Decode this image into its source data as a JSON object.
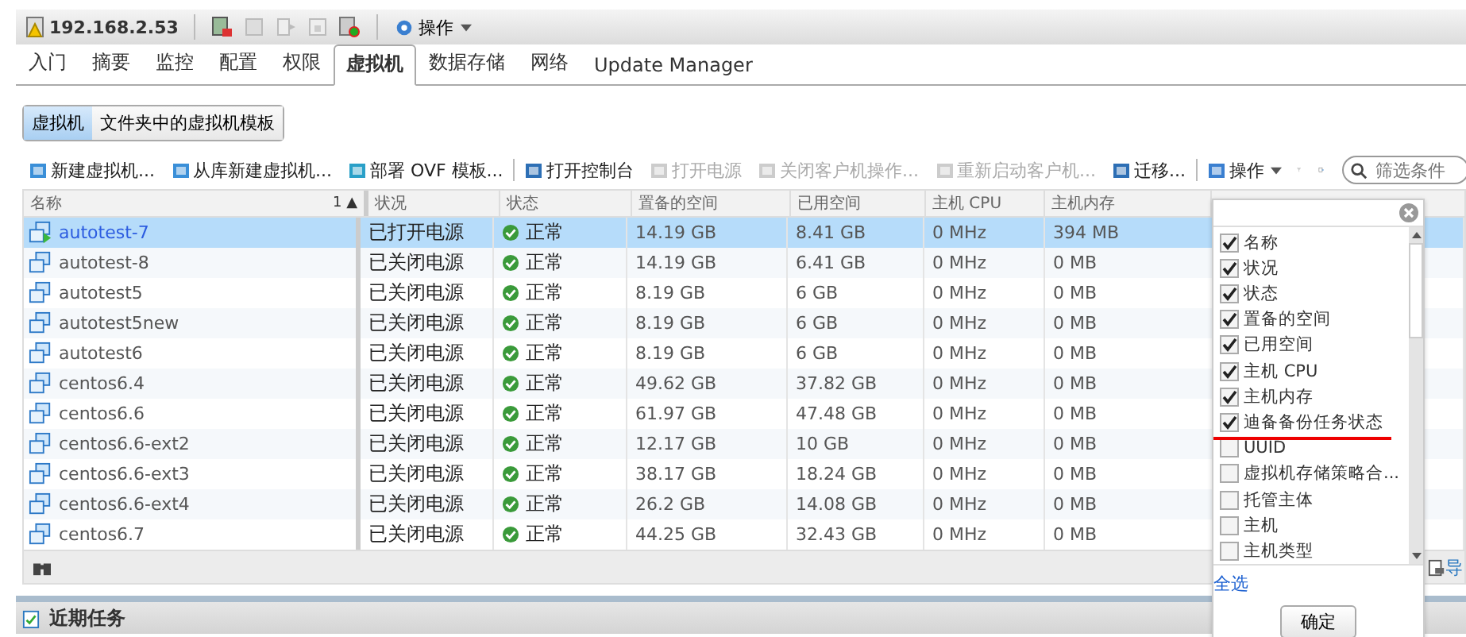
{
  "host": {
    "title": "192.168.2.53",
    "actions": "操作"
  },
  "tabs": [
    {
      "label": "入门",
      "selected": false
    },
    {
      "label": "摘要",
      "selected": false
    },
    {
      "label": "监控",
      "selected": false
    },
    {
      "label": "配置",
      "selected": false
    },
    {
      "label": "权限",
      "selected": false
    },
    {
      "label": "虚拟机",
      "selected": true
    },
    {
      "label": "数据存储",
      "selected": false
    },
    {
      "label": "网络",
      "selected": false
    },
    {
      "label": "Update Manager",
      "selected": false
    }
  ],
  "subtabs": [
    {
      "label": "虚拟机",
      "selected": true
    },
    {
      "label": "文件夹中的虚拟机模板",
      "selected": false
    }
  ],
  "toolbar": [
    {
      "label": "新建虚拟机...",
      "disabled": false
    },
    {
      "label": "从库新建虚拟机...",
      "disabled": false
    },
    {
      "label": "部署 OVF 模板...",
      "disabled": false
    },
    {
      "label": "打开控制台",
      "disabled": false
    },
    {
      "label": "打开电源",
      "disabled": true
    },
    {
      "label": "关闭客户机操作...",
      "disabled": true
    },
    {
      "label": "重新启动客户机...",
      "disabled": true
    },
    {
      "label": "迁移...",
      "disabled": false
    },
    {
      "label": "操作",
      "disabled": false
    }
  ],
  "filter": {
    "placeholder": "筛选条件"
  },
  "table": {
    "columns": [
      {
        "label": "名称",
        "sort": "1 ▲"
      },
      {
        "label": "状况"
      },
      {
        "label": "状态"
      },
      {
        "label": "置备的空间"
      },
      {
        "label": "已用空间"
      },
      {
        "label": "主机 CPU"
      },
      {
        "label": "主机内存"
      }
    ],
    "rows": [
      {
        "name": "autotest-7",
        "running": true,
        "selected": true,
        "power": "已打开电源",
        "status": "正常",
        "provisioned": "14.19  GB",
        "used": "8.41  GB",
        "cpu": "0 MHz",
        "memory": "394 MB"
      },
      {
        "name": "autotest-8",
        "running": false,
        "selected": false,
        "power": "已关闭电源",
        "status": "正常",
        "provisioned": "14.19  GB",
        "used": "6.41  GB",
        "cpu": "0 MHz",
        "memory": "0 MB"
      },
      {
        "name": "autotest5",
        "running": false,
        "selected": false,
        "power": "已关闭电源",
        "status": "正常",
        "provisioned": "8.19  GB",
        "used": "6  GB",
        "cpu": "0 MHz",
        "memory": "0 MB"
      },
      {
        "name": "autotest5new",
        "running": false,
        "selected": false,
        "power": "已关闭电源",
        "status": "正常",
        "provisioned": "8.19  GB",
        "used": "6  GB",
        "cpu": "0 MHz",
        "memory": "0 MB"
      },
      {
        "name": "autotest6",
        "running": false,
        "selected": false,
        "power": "已关闭电源",
        "status": "正常",
        "provisioned": "8.19  GB",
        "used": "6  GB",
        "cpu": "0 MHz",
        "memory": "0 MB"
      },
      {
        "name": "centos6.4",
        "running": false,
        "selected": false,
        "power": "已关闭电源",
        "status": "正常",
        "provisioned": "49.62  GB",
        "used": "37.82  GB",
        "cpu": "0 MHz",
        "memory": "0 MB"
      },
      {
        "name": "centos6.6",
        "running": false,
        "selected": false,
        "power": "已关闭电源",
        "status": "正常",
        "provisioned": "61.97  GB",
        "used": "47.48  GB",
        "cpu": "0 MHz",
        "memory": "0 MB"
      },
      {
        "name": "centos6.6-ext2",
        "running": false,
        "selected": false,
        "power": "已关闭电源",
        "status": "正常",
        "provisioned": "12.17  GB",
        "used": "10  GB",
        "cpu": "0 MHz",
        "memory": "0 MB"
      },
      {
        "name": "centos6.6-ext3",
        "running": false,
        "selected": false,
        "power": "已关闭电源",
        "status": "正常",
        "provisioned": "38.17  GB",
        "used": "18.24  GB",
        "cpu": "0 MHz",
        "memory": "0 MB"
      },
      {
        "name": "centos6.6-ext4",
        "running": false,
        "selected": false,
        "power": "已关闭电源",
        "status": "正常",
        "provisioned": "26.2  GB",
        "used": "14.08  GB",
        "cpu": "0 MHz",
        "memory": "0 MB"
      },
      {
        "name": "centos6.7",
        "running": false,
        "selected": false,
        "power": "已关闭电源",
        "status": "正常",
        "provisioned": "44.25  GB",
        "used": "32.43  GB",
        "cpu": "0 MHz",
        "memory": "0 MB"
      }
    ]
  },
  "footer": {
    "export": "导"
  },
  "column_menu": {
    "items": [
      {
        "label": "名称",
        "checked": true
      },
      {
        "label": "状况",
        "checked": true
      },
      {
        "label": "状态",
        "checked": true
      },
      {
        "label": "置备的空间",
        "checked": true
      },
      {
        "label": "已用空间",
        "checked": true
      },
      {
        "label": "主机 CPU",
        "checked": true
      },
      {
        "label": "主机内存",
        "checked": true
      },
      {
        "label": "迪备备份任务状态",
        "checked": true
      },
      {
        "label": "UUID",
        "checked": false
      },
      {
        "label": "虚拟机存储策略合...",
        "checked": false
      },
      {
        "label": "托管主体",
        "checked": false
      },
      {
        "label": "主机",
        "checked": false
      },
      {
        "label": "主机类型",
        "checked": false
      }
    ],
    "select_all": "全选",
    "ok": "确定"
  },
  "recent_tasks": {
    "title": "近期任务"
  }
}
